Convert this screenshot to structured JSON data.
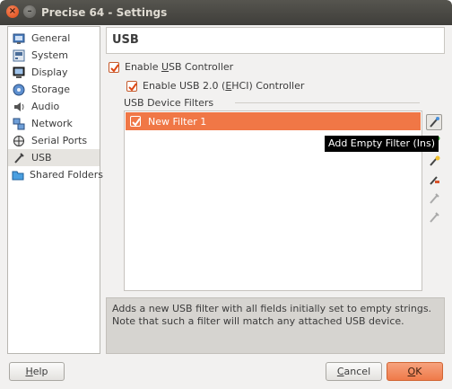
{
  "window": {
    "title": "Precise 64 - Settings"
  },
  "sidebar": {
    "items": [
      {
        "label": "General",
        "icon": "general-icon"
      },
      {
        "label": "System",
        "icon": "system-icon"
      },
      {
        "label": "Display",
        "icon": "display-icon"
      },
      {
        "label": "Storage",
        "icon": "storage-icon"
      },
      {
        "label": "Audio",
        "icon": "audio-icon"
      },
      {
        "label": "Network",
        "icon": "network-icon"
      },
      {
        "label": "Serial Ports",
        "icon": "serial-ports-icon"
      },
      {
        "label": "USB",
        "icon": "usb-icon",
        "selected": true
      },
      {
        "label": "Shared Folders",
        "icon": "shared-folders-icon"
      }
    ]
  },
  "page": {
    "title": "USB",
    "enable_usb": {
      "prefix": "Enable ",
      "mnemonic": "U",
      "suffix": "SB Controller",
      "checked": true
    },
    "enable_usb2": {
      "prefix": "Enable USB 2.0 (",
      "mnemonic": "E",
      "suffix": "HCI) Controller",
      "checked": true
    },
    "filters_group_label": "USB Device Filters",
    "filters": [
      {
        "label": "New Filter 1",
        "checked": true
      }
    ],
    "tools": [
      "add-empty-filter-icon",
      "add-filter-from-device-icon",
      "edit-filter-icon",
      "remove-filter-icon",
      "move-filter-up-icon",
      "move-filter-down-icon"
    ],
    "tooltip": "Add Empty Filter (Ins)",
    "description": "Adds a new USB filter with all fields initially set to empty strings. Note that such a filter will match any attached USB device."
  },
  "buttons": {
    "help": {
      "mnemonic": "H",
      "rest": "elp"
    },
    "cancel": {
      "mnemonic": "C",
      "rest": "ancel"
    },
    "ok": {
      "mnemonic": "O",
      "rest": "K"
    }
  },
  "colors": {
    "accent": "#f07746",
    "titlebar": "#3f3e3a",
    "close": "#dd4814"
  }
}
